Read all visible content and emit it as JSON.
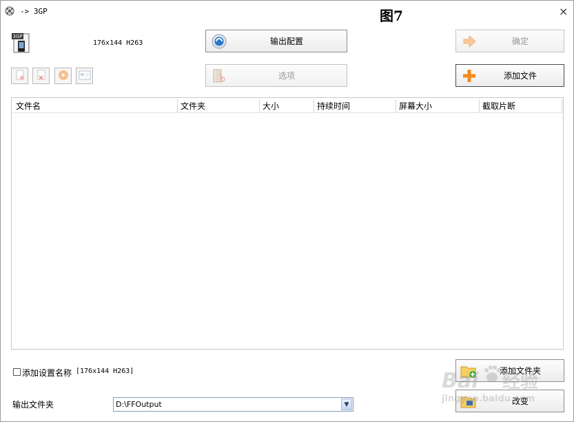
{
  "window": {
    "title": "-> 3GP",
    "overlay_label": "图7",
    "close_glyph": "×",
    "app_icon": "film-reel-icon"
  },
  "profile": {
    "icon_badge": "3GP",
    "summary": "176x144 H263"
  },
  "buttons": {
    "output_config": "输出配置",
    "options": "选项",
    "ok": "确定",
    "add_file": "添加文件",
    "add_folder": "添加文件夹",
    "change": "改变"
  },
  "toolbar": [
    {
      "name": "remove-file-icon"
    },
    {
      "name": "clear-list-icon"
    },
    {
      "name": "play-icon"
    },
    {
      "name": "media-info-icon"
    }
  ],
  "file_table": {
    "columns": [
      "文件名",
      "文件夹",
      "大小",
      "持续时间",
      "屏幕大小",
      "截取片断"
    ],
    "rows": []
  },
  "settings_name": {
    "checked": false,
    "label": "添加设置名称",
    "value": "[176x144 H263]"
  },
  "output_folder": {
    "label": "输出文件夹",
    "value": "D:\\FFOutput"
  },
  "watermark": {
    "brand": "Bai",
    "cn": "经验",
    "url": "jingyan.baidu.com"
  },
  "colors": {
    "orange_accent": "#f08a1c",
    "disabled_text": "#9a9a9a",
    "border": "#8c8c8c"
  }
}
